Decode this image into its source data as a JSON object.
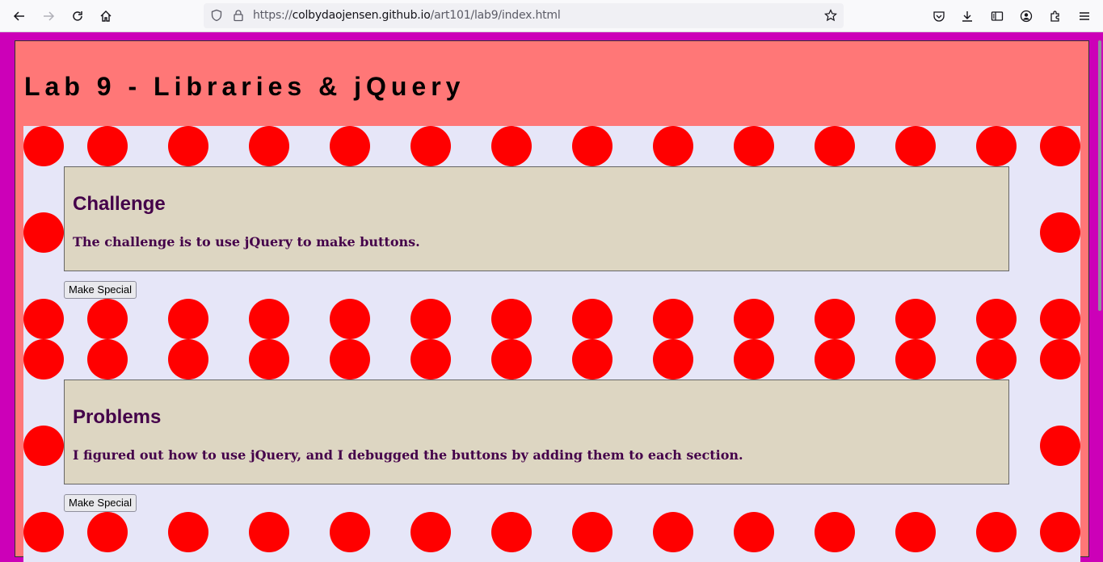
{
  "browser": {
    "url_prefix": "https://",
    "url_host": "colbydaojensen.github.io",
    "url_path": "/art101/lab9/index.html"
  },
  "page": {
    "title": "Lab 9 - Libraries & jQuery"
  },
  "sections": [
    {
      "heading": "Challenge",
      "text": "The challenge is to use jQuery to make buttons.",
      "button_label": "Make Special"
    },
    {
      "heading": "Problems",
      "text": "I figured out how to use jQuery, and I debugged the buttons by adding them to each section.",
      "button_label": "Make Special"
    }
  ],
  "colors": {
    "outer_background": "#cc00b8",
    "header_background": "#ff7777",
    "content_background": "#e6e6f8",
    "dot": "#ff0000",
    "card_background": "#ddd6c2",
    "card_text": "#44004a"
  }
}
